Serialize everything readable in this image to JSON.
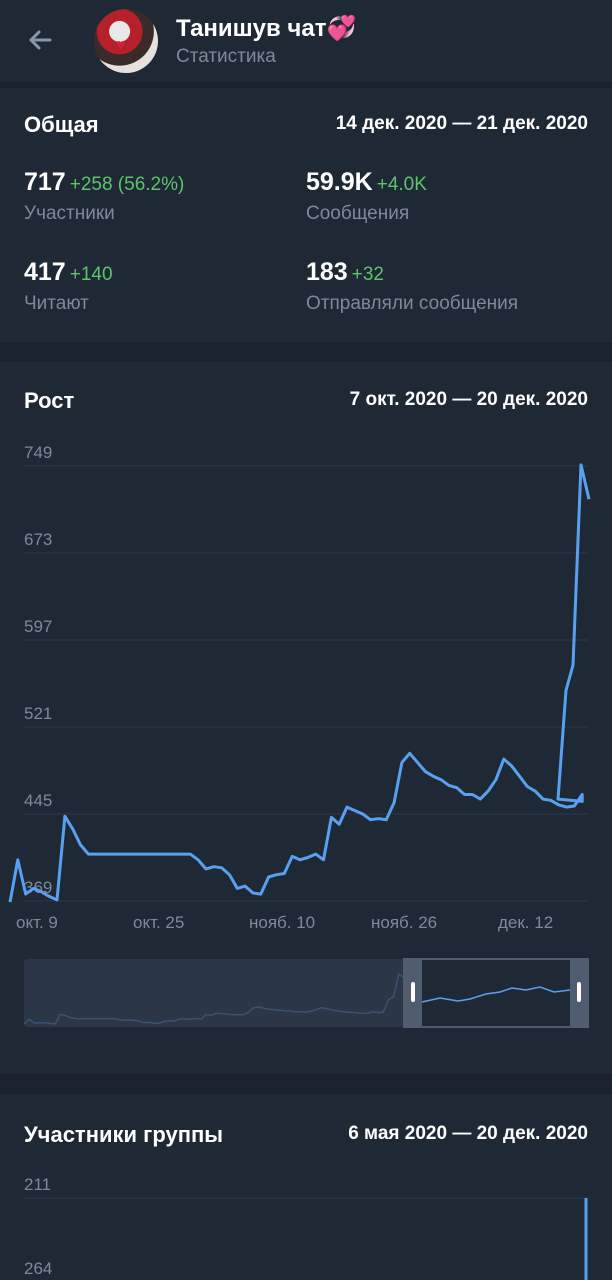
{
  "header": {
    "title": "Танишув чат",
    "title_emoji": "💞",
    "subtitle": "Статистика",
    "back_icon": "arrow-left-icon"
  },
  "overview": {
    "title": "Общая",
    "range": "14 дек. 2020 — 21 дек. 2020",
    "stats": [
      {
        "value": "717",
        "delta": "+258 (56.2%)",
        "label": "Участники"
      },
      {
        "value": "59.9K",
        "delta": "+4.0K",
        "label": "Сообщения"
      },
      {
        "value": "417",
        "delta": "+140",
        "label": "Читают"
      },
      {
        "value": "183",
        "delta": "+32",
        "label": "Отправляли сообщения"
      }
    ]
  },
  "growth": {
    "title": "Рост",
    "range": "7 окт. 2020 — 20 дек. 2020"
  },
  "members": {
    "title": "Участники группы",
    "range": "6 мая 2020 — 20 дек. 2020"
  },
  "colors": {
    "accent_line": "#5aa0f0",
    "positive": "#5ec46a",
    "background": "#1a2230",
    "card": "#1f2936"
  },
  "chart_data": [
    {
      "type": "line",
      "title": "Рост",
      "y_ticks": [
        369,
        445,
        521,
        597,
        673,
        749
      ],
      "x_ticks": [
        "окт. 9",
        "окт. 25",
        "нояб. 10",
        "нояб. 26",
        "дек. 12"
      ],
      "ylim": [
        369,
        749
      ],
      "x_start": "2020-10-07",
      "x_end": "2020-12-20",
      "series": [
        {
          "values": [
            [
              "2020-10-07",
              368
            ],
            [
              "2020-10-08",
              405
            ],
            [
              "2020-10-09",
              375
            ],
            [
              "2020-10-10",
              380
            ],
            [
              "2020-10-11",
              377
            ],
            [
              "2020-10-12",
              373
            ],
            [
              "2020-10-13",
              370
            ],
            [
              "2020-10-14",
              443
            ],
            [
              "2020-10-15",
              432
            ],
            [
              "2020-10-16",
              418
            ],
            [
              "2020-10-17",
              410
            ],
            [
              "2020-10-18",
              410
            ],
            [
              "2020-10-20",
              410
            ],
            [
              "2020-10-22",
              410
            ],
            [
              "2020-10-24",
              410
            ],
            [
              "2020-10-26",
              410
            ],
            [
              "2020-10-28",
              410
            ],
            [
              "2020-10-30",
              410
            ],
            [
              "2020-10-31",
              405
            ],
            [
              "2020-11-01",
              397
            ],
            [
              "2020-11-02",
              399
            ],
            [
              "2020-11-03",
              398
            ],
            [
              "2020-11-04",
              392
            ],
            [
              "2020-11-05",
              380
            ],
            [
              "2020-11-06",
              382
            ],
            [
              "2020-11-07",
              376
            ],
            [
              "2020-11-08",
              375
            ],
            [
              "2020-11-09",
              390
            ],
            [
              "2020-11-10",
              392
            ],
            [
              "2020-11-11",
              393
            ],
            [
              "2020-11-12",
              408
            ],
            [
              "2020-11-13",
              405
            ],
            [
              "2020-11-14",
              407
            ],
            [
              "2020-11-15",
              410
            ],
            [
              "2020-11-16",
              405
            ],
            [
              "2020-11-17",
              442
            ],
            [
              "2020-11-18",
              436
            ],
            [
              "2020-11-19",
              451
            ],
            [
              "2020-11-20",
              448
            ],
            [
              "2020-11-21",
              445
            ],
            [
              "2020-11-22",
              440
            ],
            [
              "2020-11-23",
              441
            ],
            [
              "2020-11-24",
              440
            ],
            [
              "2020-11-25",
              455
            ],
            [
              "2020-11-26",
              490
            ],
            [
              "2020-11-27",
              498
            ],
            [
              "2020-11-28",
              490
            ],
            [
              "2020-11-29",
              482
            ],
            [
              "2020-11-30",
              478
            ],
            [
              "2020-12-01",
              475
            ],
            [
              "2020-12-02",
              470
            ],
            [
              "2020-12-03",
              468
            ],
            [
              "2020-12-04",
              462
            ],
            [
              "2020-12-05",
              462
            ],
            [
              "2020-12-06",
              458
            ],
            [
              "2020-12-07",
              465
            ],
            [
              "2020-12-08",
              475
            ],
            [
              "2020-12-09",
              493
            ],
            [
              "2020-12-10",
              487
            ],
            [
              "2020-12-11",
              478
            ],
            [
              "2020-12-12",
              469
            ],
            [
              "2020-12-13",
              465
            ],
            [
              "2020-12-14",
              458
            ],
            [
              "2020-12-15",
              457
            ],
            [
              "2020-12-16",
              453
            ],
            [
              "2020-12-17",
              451
            ],
            [
              "2020-12-18",
              452
            ],
            [
              "2020-12-19",
              462
            ],
            [
              "2020-12-19",
              456
            ],
            [
              "2020-12-20",
              458
            ],
            [
              "2020-12-20",
              553
            ],
            [
              "2020-12-20",
              575
            ],
            [
              "2020-12-20",
              750
            ],
            [
              "2020-12-20",
              720
            ]
          ]
        }
      ]
    },
    {
      "type": "line",
      "title": "Участники группы",
      "y_ticks": [
        211,
        264
      ]
    }
  ]
}
